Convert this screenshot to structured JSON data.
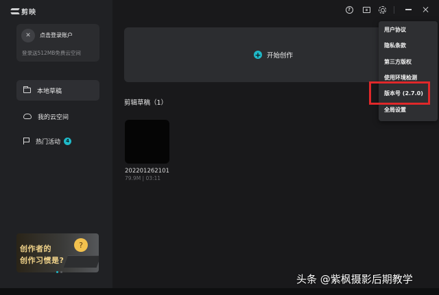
{
  "app": {
    "logo_text": "剪映"
  },
  "sidebar": {
    "account": {
      "avatar_glyph": "✕",
      "login_label": "点击登录账户",
      "cloud_promo": "登录送512MB免费云空间"
    },
    "items": [
      {
        "label": "本地草稿",
        "icon": "folder-icon",
        "active": true
      },
      {
        "label": "我的云空间",
        "icon": "cloud-icon",
        "active": false
      },
      {
        "label": "热门活动",
        "icon": "flag-icon",
        "active": false,
        "badge": "4"
      }
    ],
    "promo": {
      "line1": "创作者的",
      "line2": "创作习惯是?",
      "face_glyph": "?"
    }
  },
  "main": {
    "start_label": "开始创作",
    "drafts_title": "剪辑草稿（1）",
    "drafts": [
      {
        "name": "202201262101",
        "meta": "79.9M | 03:11"
      }
    ]
  },
  "titlebar": {
    "help_glyph": "?",
    "icons": [
      "help-icon",
      "feedback-icon",
      "gear-icon",
      "minimize-icon",
      "close-icon"
    ]
  },
  "menu": {
    "items": [
      "用户协议",
      "隐私条款",
      "第三方版权",
      "使用环境检测",
      "版本号 (2.7.0)",
      "全局设置"
    ],
    "highlight_color": "#e0282a"
  },
  "watermark": "头条 @紫枫摄影后期教学",
  "colors": {
    "accent": "#1fb9c8",
    "highlight": "#e0282a"
  }
}
